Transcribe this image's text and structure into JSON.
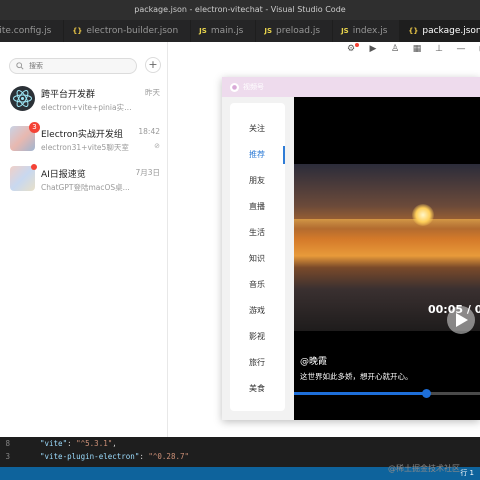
{
  "window_title": "package.json - electron-vitechat - Visual Studio Code",
  "tabs": [
    {
      "icon": "",
      "label": "vite.config.js",
      "active": false
    },
    {
      "icon": "{}",
      "label": "electron-builder.json",
      "active": false
    },
    {
      "icon": "JS",
      "label": "main.js",
      "active": false
    },
    {
      "icon": "JS",
      "label": "preload.js",
      "active": false
    },
    {
      "icon": "JS",
      "label": "index.js",
      "active": false
    },
    {
      "icon": "{}",
      "label": "package.json",
      "active": true
    }
  ],
  "sidebar": {
    "search_placeholder": "搜索",
    "add_label": "+",
    "chats": [
      {
        "name": "跨平台开发群",
        "message": "electron+vite+pinia实战项目...",
        "time": "昨天",
        "badge": "",
        "muted": ""
      },
      {
        "name": "Electron实战开发组",
        "message": "electron31+vite5聊天室",
        "time": "18:42",
        "badge": "3",
        "muted": "⊘"
      },
      {
        "name": "AI日报速览",
        "message": "ChatGPT登陆macOS桌...",
        "time": "7月3日",
        "badge": "",
        "muted": ""
      }
    ]
  },
  "video_window": {
    "title": "视频号",
    "menu": [
      "关注",
      "推荐",
      "朋友",
      "直播",
      "生活",
      "知识",
      "音乐",
      "游戏",
      "影视",
      "旅行",
      "美食"
    ],
    "active_menu": 1,
    "player": {
      "time": "00:05 / 00:1",
      "author": "@晚霞",
      "description": "这世界如此多娇，想开心就开心。",
      "progress": 0.71
    }
  },
  "code": {
    "lines": [
      {
        "num": "8",
        "key": "\"vite\"",
        "value": "\"^5.3.1\"",
        "suffix": ","
      },
      {
        "num": "3",
        "key": "\"vite-plugin-electron\"",
        "value": "\"^0.28.7\"",
        "suffix": ""
      }
    ]
  },
  "status": {
    "right": "行 1"
  },
  "watermark": "@稀土掘金技术社区"
}
